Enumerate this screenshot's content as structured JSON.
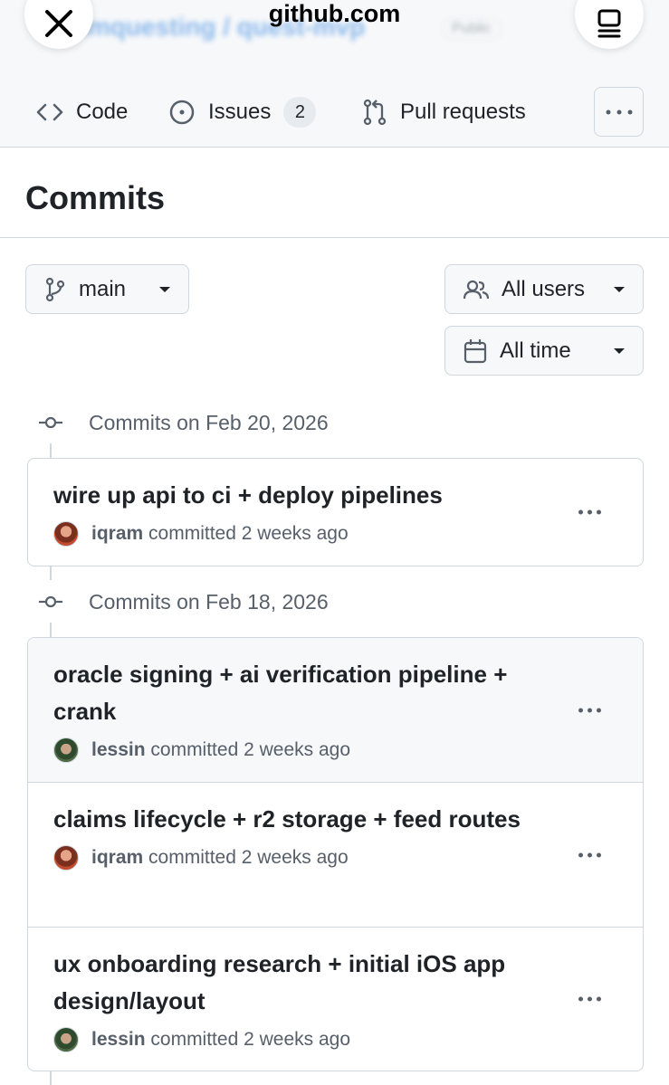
{
  "browser": {
    "site": "github.com",
    "repo_path": "himquesting / quest-mvp",
    "visibility": "Public"
  },
  "repo_nav": {
    "code": "Code",
    "issues": "Issues",
    "issues_count": "2",
    "pull_requests": "Pull requests"
  },
  "page": {
    "title": "Commits"
  },
  "filters": {
    "branch": "main",
    "users": "All users",
    "time": "All time"
  },
  "groups": [
    {
      "header": "Commits on Feb 20, 2026",
      "commits": [
        {
          "message": "wire up api to ci + deploy pipelines",
          "author": "iqram",
          "action": "committed",
          "time": "2 weeks ago"
        }
      ]
    },
    {
      "header": "Commits on Feb 18, 2026",
      "commits": [
        {
          "message": "oracle signing + ai verification pipeline + crank",
          "author": "lessin",
          "action": "committed",
          "time": "2 weeks ago"
        },
        {
          "message": "claims lifecycle + r2 storage + feed routes",
          "author": "iqram",
          "action": "committed",
          "time": "2 weeks ago"
        },
        {
          "message": "ux onboarding research + initial iOS app design/layout",
          "author": "lessin",
          "action": "committed",
          "time": "2 weeks ago"
        }
      ]
    }
  ],
  "colors": {
    "accent": "#0969da",
    "text": "#1f2328",
    "muted": "#57606a",
    "border": "#d0d7de",
    "subtle_bg": "#f6f8fa"
  }
}
